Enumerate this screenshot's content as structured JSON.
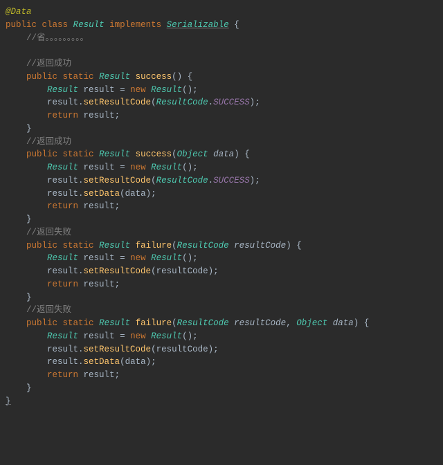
{
  "lines": {
    "0": "@Data",
    "1": {
      "a": "public",
      "b": "class",
      "c": "Result",
      "d": "implements",
      "e": "Serializable",
      "f": "{"
    },
    "2": "//省。。。。。。。。。",
    "3": "//返回成功",
    "4": {
      "a": "public",
      "b": "static",
      "c": "Result",
      "d": "success",
      "e": "() {"
    },
    "5": {
      "a": "Result",
      "b": "result",
      "c": "=",
      "d": "new",
      "e": "Result",
      "f": "();"
    },
    "6": {
      "a": "result",
      "b": "setResultCode",
      "c": "ResultCode",
      "d": "SUCCESS",
      "e": ");"
    },
    "7": {
      "a": "return",
      "b": "result"
    },
    "8": "}",
    "9": "//返回成功",
    "10": {
      "a": "public",
      "b": "static",
      "c": "Result",
      "d": "success",
      "e": "Object",
      "f": "data",
      "g": ") {"
    },
    "11": {
      "a": "Result",
      "b": "result",
      "c": "=",
      "d": "new",
      "e": "Result",
      "f": "();"
    },
    "12": {
      "a": "result",
      "b": "setResultCode",
      "c": "ResultCode",
      "d": "SUCCESS",
      "e": ");"
    },
    "13": {
      "a": "result",
      "b": "setData",
      "c": "data",
      "d": ");"
    },
    "14": {
      "a": "return",
      "b": "result"
    },
    "15": "}",
    "16": "//返回失败",
    "17": {
      "a": "public",
      "b": "static",
      "c": "Result",
      "d": "failure",
      "e": "ResultCode",
      "f": "resultCode",
      "g": ") {"
    },
    "18": {
      "a": "Result",
      "b": "result",
      "c": "=",
      "d": "new",
      "e": "Result",
      "f": "();"
    },
    "19": {
      "a": "result",
      "b": "setResultCode",
      "c": "resultCode",
      "d": ");"
    },
    "20": {
      "a": "return",
      "b": "result"
    },
    "21": "}",
    "22": "//返回失败",
    "23": {
      "a": "public",
      "b": "static",
      "c": "Result",
      "d": "failure",
      "e": "ResultCode",
      "f": "resultCode",
      "g": "Object",
      "h": "data",
      "i": ") {"
    },
    "24": {
      "a": "Result",
      "b": "result",
      "c": "=",
      "d": "new",
      "e": "Result",
      "f": "();"
    },
    "25": {
      "a": "result",
      "b": "setResultCode",
      "c": "resultCode",
      "d": ");"
    },
    "26": {
      "a": "result",
      "b": "setData",
      "c": "data",
      "d": ");"
    },
    "27": {
      "a": "return",
      "b": "result"
    },
    "28": "}",
    "29": "}"
  }
}
